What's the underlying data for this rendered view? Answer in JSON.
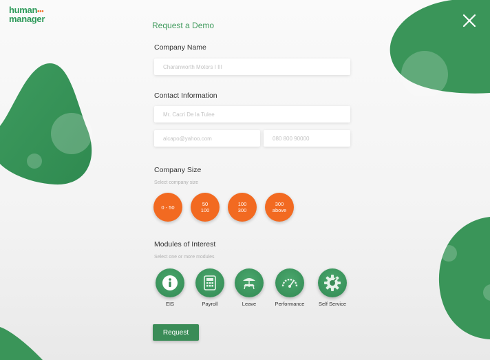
{
  "brand": {
    "logo_line1": "human",
    "logo_line2": "manager",
    "logo_dots": "•••"
  },
  "colors": {
    "primary_green": "#3a8c57",
    "accent_orange": "#f26a21"
  },
  "form": {
    "title": "Request a Demo",
    "company_name": {
      "label": "Company Name",
      "placeholder": "Charanworth Motors I III"
    },
    "contact": {
      "label": "Contact Information",
      "name_placeholder": "Mr. Cacri De la Tulee",
      "email_placeholder": "alcapo@yahoo.com",
      "phone_placeholder": "080 800 90000"
    },
    "company_size": {
      "label": "Company Size",
      "hint": "Select company size",
      "options": [
        {
          "line1": "0 - 50",
          "line2": ""
        },
        {
          "line1": "50",
          "line2": "100"
        },
        {
          "line1": "100",
          "line2": "300"
        },
        {
          "line1": "300",
          "line2": "above"
        }
      ]
    },
    "modules": {
      "label": "Modules of Interest",
      "hint": "Select one or more modules",
      "items": [
        {
          "label": "EIS",
          "icon": "info-icon"
        },
        {
          "label": "Payroll",
          "icon": "calculator-icon"
        },
        {
          "label": "Leave",
          "icon": "beach-chair-icon"
        },
        {
          "label": "Performance",
          "icon": "gauge-icon"
        },
        {
          "label": "Self Service",
          "icon": "gear-icon"
        }
      ]
    },
    "submit_label": "Request"
  }
}
